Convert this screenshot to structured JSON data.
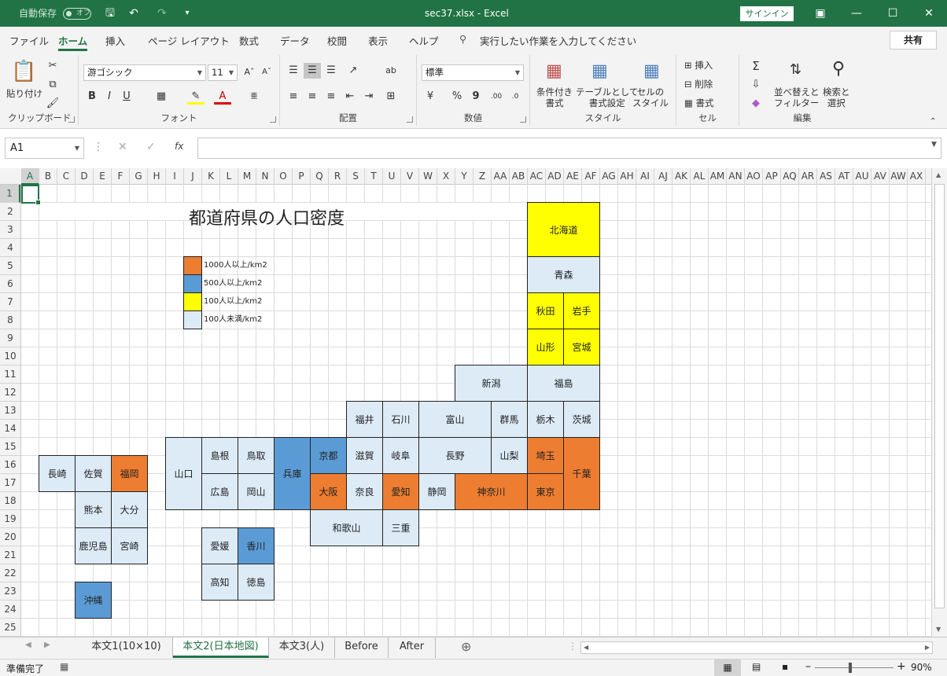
{
  "titlebar": {
    "autosave_label": "自動保存",
    "autosave_state": "オフ",
    "document_title": "sec37.xlsx  -  Excel",
    "signin_label": "サインイン"
  },
  "menu": {
    "tabs": [
      "ファイル",
      "ホーム",
      "挿入",
      "ページ レイアウト",
      "数式",
      "データ",
      "校閲",
      "表示",
      "ヘルプ"
    ],
    "search_placeholder": "実行したい作業を入力してください",
    "share_label": "共有"
  },
  "ribbon": {
    "clipboard": {
      "label": "クリップボード",
      "paste": "貼り付け"
    },
    "font": {
      "label": "フォント",
      "name": "游ゴシック",
      "size": "11"
    },
    "alignment": {
      "label": "配置"
    },
    "number": {
      "label": "数値",
      "format": "標準"
    },
    "styles": {
      "label": "スタイル",
      "cond": "条件付き\n書式",
      "table": "テーブルとして\n書式設定",
      "cell": "セルの\nスタイル"
    },
    "cells": {
      "label": "セル",
      "insert": "挿入",
      "delete": "削除",
      "format": "書式"
    },
    "editing": {
      "label": "編集",
      "sort": "並べ替えと\nフィルター",
      "find": "検索と\n選択"
    }
  },
  "formula": {
    "namebox": "A1",
    "content": ""
  },
  "columns": [
    "A",
    "B",
    "C",
    "D",
    "E",
    "F",
    "G",
    "H",
    "I",
    "J",
    "K",
    "L",
    "M",
    "N",
    "O",
    "P",
    "Q",
    "R",
    "S",
    "T",
    "U",
    "V",
    "W",
    "X",
    "Y",
    "Z",
    "AA",
    "AB",
    "AC",
    "AD",
    "AE",
    "AF",
    "AG",
    "AH",
    "AI",
    "AJ",
    "AK",
    "AL",
    "AM",
    "AN",
    "AO",
    "AP",
    "AQ",
    "AR",
    "AS",
    "AT",
    "AU",
    "AV",
    "AW",
    "AX"
  ],
  "rows": [
    "1",
    "2",
    "3",
    "4",
    "5",
    "6",
    "7",
    "8",
    "9",
    "10",
    "11",
    "12",
    "13",
    "14",
    "15",
    "16",
    "17",
    "18",
    "19",
    "20",
    "21",
    "22",
    "23",
    "24",
    "25"
  ],
  "sheet": {
    "title": "都道府県の人口密度",
    "colors": {
      "high": "#ED7D31",
      "mid": "#5B9BD5",
      "low": "#FFFF00",
      "min": "#DDEBF7"
    },
    "legend": [
      {
        "label": "1000人以上/km2",
        "level": "high"
      },
      {
        "label": "500人以上/km2",
        "level": "mid"
      },
      {
        "label": "100人以上/km2",
        "level": "low"
      },
      {
        "label": "100人未満/km2",
        "level": "min"
      }
    ],
    "prefectures": [
      {
        "name": "北海道",
        "level": "low"
      },
      {
        "name": "青森",
        "level": "min"
      },
      {
        "name": "秋田",
        "level": "low"
      },
      {
        "name": "岩手",
        "level": "low"
      },
      {
        "name": "山形",
        "level": "low"
      },
      {
        "name": "宮城",
        "level": "low"
      },
      {
        "name": "新潟",
        "level": "min"
      },
      {
        "name": "福島",
        "level": "min"
      },
      {
        "name": "福井",
        "level": "min"
      },
      {
        "name": "石川",
        "level": "min"
      },
      {
        "name": "富山",
        "level": "min"
      },
      {
        "name": "群馬",
        "level": "min"
      },
      {
        "name": "栃木",
        "level": "min"
      },
      {
        "name": "茨城",
        "level": "min"
      },
      {
        "name": "山口",
        "level": "min"
      },
      {
        "name": "島根",
        "level": "min"
      },
      {
        "name": "鳥取",
        "level": "min"
      },
      {
        "name": "兵庫",
        "level": "mid"
      },
      {
        "name": "京都",
        "level": "mid"
      },
      {
        "name": "滋賀",
        "level": "min"
      },
      {
        "name": "岐阜",
        "level": "min"
      },
      {
        "name": "長野",
        "level": "min"
      },
      {
        "name": "山梨",
        "level": "min"
      },
      {
        "name": "埼玉",
        "level": "high"
      },
      {
        "name": "千葉",
        "level": "high"
      },
      {
        "name": "長崎",
        "level": "min"
      },
      {
        "name": "佐賀",
        "level": "min"
      },
      {
        "name": "福岡",
        "level": "high"
      },
      {
        "name": "広島",
        "level": "min"
      },
      {
        "name": "岡山",
        "level": "min"
      },
      {
        "name": "大阪",
        "level": "high"
      },
      {
        "name": "奈良",
        "level": "min"
      },
      {
        "name": "愛知",
        "level": "high"
      },
      {
        "name": "静岡",
        "level": "min"
      },
      {
        "name": "神奈川",
        "level": "high"
      },
      {
        "name": "東京",
        "level": "high"
      },
      {
        "name": "熊本",
        "level": "min"
      },
      {
        "name": "大分",
        "level": "min"
      },
      {
        "name": "和歌山",
        "level": "min"
      },
      {
        "name": "三重",
        "level": "min"
      },
      {
        "name": "鹿児島",
        "level": "min"
      },
      {
        "name": "宮崎",
        "level": "min"
      },
      {
        "name": "愛媛",
        "level": "min"
      },
      {
        "name": "香川",
        "level": "mid"
      },
      {
        "name": "高知",
        "level": "min"
      },
      {
        "name": "徳島",
        "level": "min"
      },
      {
        "name": "沖縄",
        "level": "mid"
      }
    ]
  },
  "sheet_tabs": [
    "本文1(10×10)",
    "本文2(日本地図)",
    "本文3(人)",
    "Before",
    "After"
  ],
  "active_sheet_tab": "本文2(日本地図)",
  "status": {
    "ready": "準備完了",
    "zoom": "90%"
  }
}
